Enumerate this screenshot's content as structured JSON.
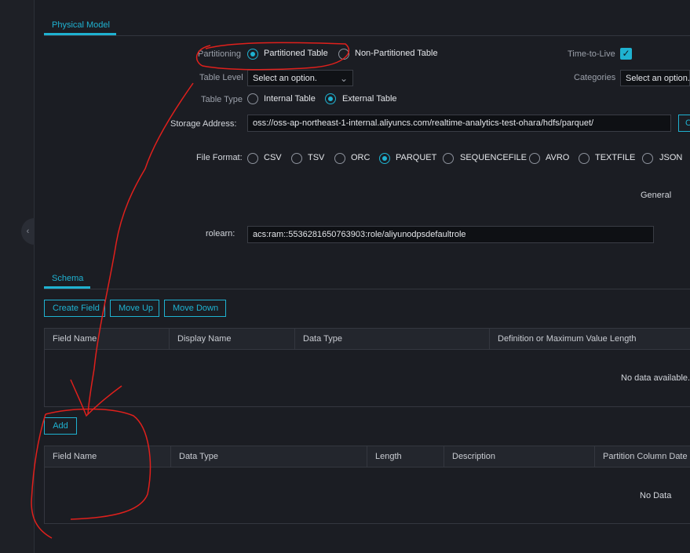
{
  "tabs": {
    "physical_model": "Physical Model",
    "schema": "Schema"
  },
  "form": {
    "partitioning": {
      "label": "Partitioning",
      "options": [
        "Partitioned Table",
        "Non-Partitioned Table"
      ],
      "selected": "Partitioned Table"
    },
    "time_to_live": {
      "label": "Time-to-Live",
      "checked": true
    },
    "table_level": {
      "label": "Table Level",
      "placeholder": "Select an option."
    },
    "categories": {
      "label": "Categories",
      "placeholder": "Select an option."
    },
    "table_type": {
      "label": "Table Type",
      "options": [
        "Internal Table",
        "External Table"
      ],
      "selected": "External Table"
    },
    "storage_address": {
      "label": "Storage Address:",
      "value": "oss://oss-ap-northeast-1-internal.aliyuncs.com/realtime-analytics-test-ohara/hdfs/parquet/"
    },
    "file_format": {
      "label": "File Format:",
      "options": [
        "CSV",
        "TSV",
        "ORC",
        "PARQUET",
        "SEQUENCEFILE",
        "AVRO",
        "TEXTFILE",
        "JSON"
      ],
      "selected": "PARQUET"
    },
    "general_label": "General",
    "rolearn": {
      "label": "rolearn:",
      "value": "acs:ram::5536281650763903:role/aliyunodpsdefaultrole"
    }
  },
  "schema": {
    "buttons": {
      "create_field": "Create Field",
      "move_up": "Move Up",
      "move_down": "Move Down"
    },
    "fields_table": {
      "columns": [
        "Field Name",
        "Display Name",
        "Data Type",
        "Definition or Maximum Value Length"
      ],
      "empty_text": "No data available."
    },
    "add_button": "Add",
    "partition_table": {
      "columns": [
        "Field Name",
        "Data Type",
        "Length",
        "Description",
        "Partition Column Date F"
      ],
      "empty_text": "No Data"
    }
  },
  "colors": {
    "accent": "#1fb2d1",
    "background": "#1b1d23",
    "annotation": "#e0201c"
  },
  "icons": {
    "collapse": "chevron-left-icon",
    "select_arrow": "chevron-down-icon",
    "checkbox": "check-icon"
  }
}
